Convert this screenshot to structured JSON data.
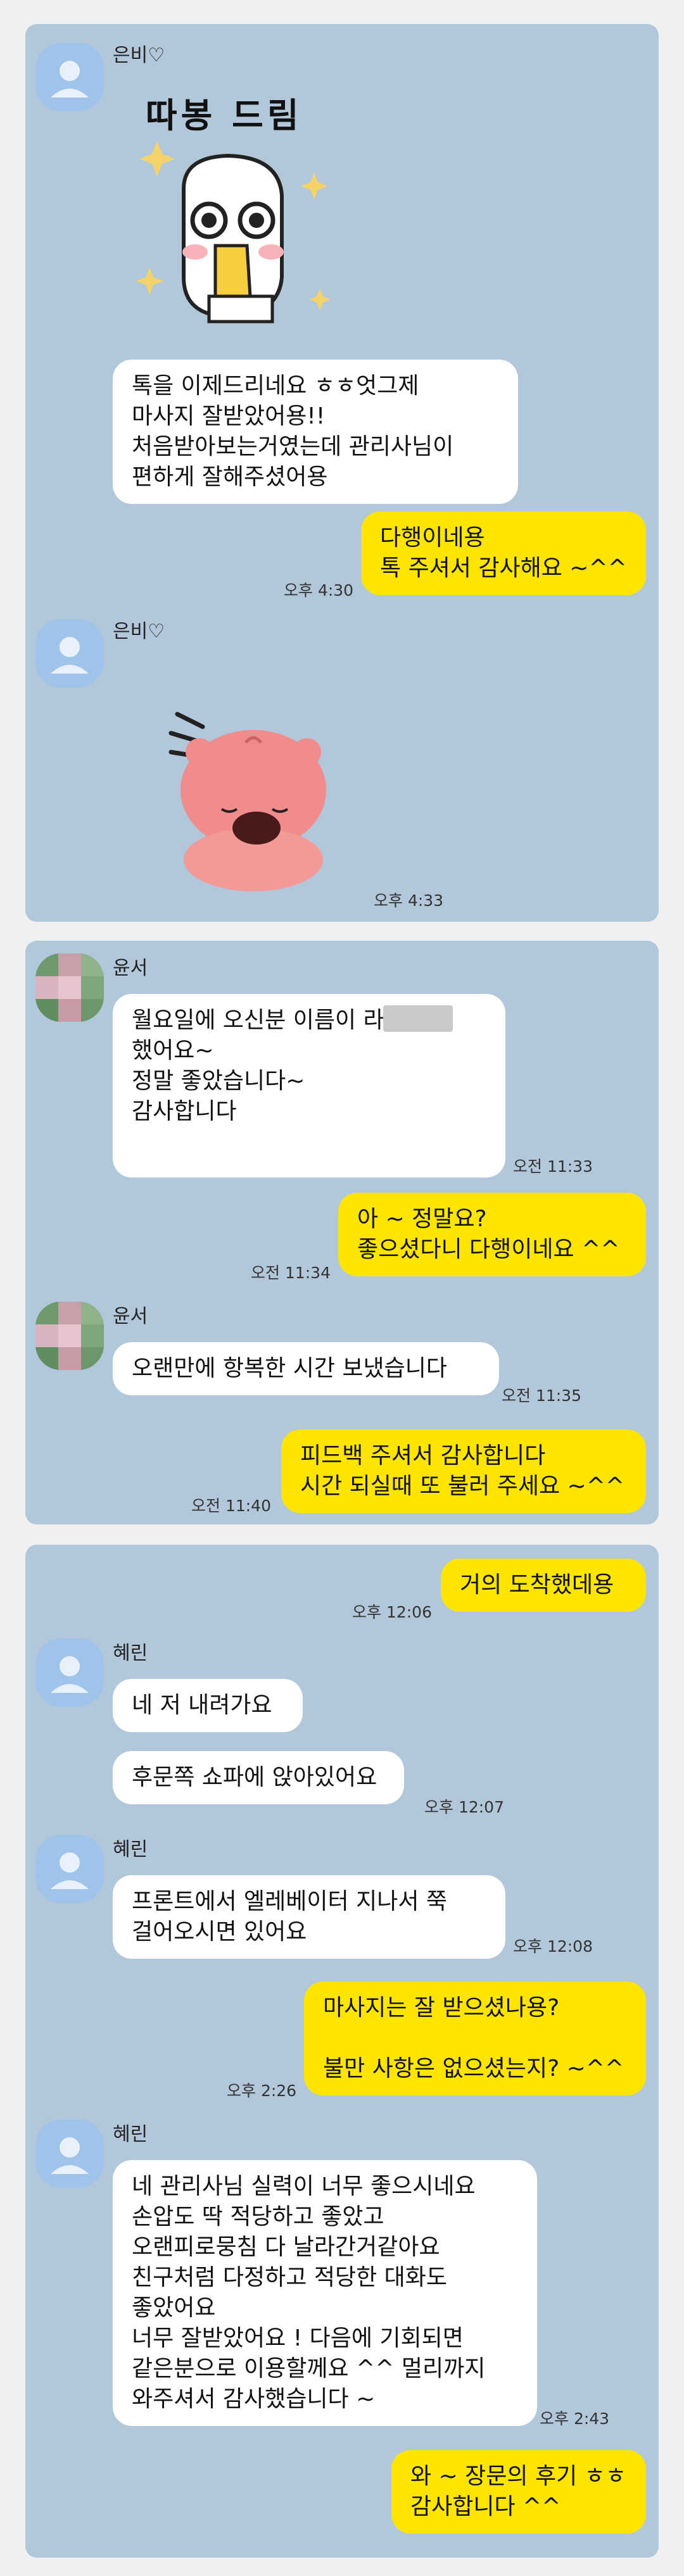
{
  "panel1": {
    "sender": "은비♡",
    "sticker_text": "따봉 드림",
    "msg1": "톡을 이제드리네요 ㅎㅎ엇그제\n마사지 잘받았어용!!\n처음받아보는거였는데 관리사님이\n편하게 잘해주셨어용",
    "reply1": "다행이네용\n톡 주셔서 감사해요 ~^^",
    "reply1_time": "오후 4:30",
    "sender2": "은비♡",
    "sticker2_time": "오후 4:33"
  },
  "panel2": {
    "sender": "윤서",
    "msg1": "월요일에 오신분 이름이  라고\n했어요~\n정말 좋았습니다~\n감사합니다",
    "msg1_time": "오전 11:33",
    "reply1": "아 ~ 정말요?\n좋으셨다니 다행이네요 ^^",
    "reply1_time": "오전 11:34",
    "sender2": "윤서",
    "msg2": "오랜만에 항복한 시간 보냈습니다",
    "msg2_time": "오전 11:35",
    "reply2": "피드백 주셔서 감사합니다\n시간 되실때 또 불러 주세요 ~^^",
    "reply2_time": "오전 11:40"
  },
  "panel3": {
    "reply1": "거의 도착했데용",
    "reply1_time": "오후 12:06",
    "sender": "혜린",
    "msg1": "네 저 내려가요",
    "msg2": "후문쪽 쇼파에 앉아있어요",
    "msg2_time": "오후 12:07",
    "sender2": "혜린",
    "msg3": "프론트에서 엘레베이터 지나서 쭉\n걸어오시면 있어요",
    "msg3_time": "오후 12:08",
    "reply2": "마사지는 잘 받으셨나용?\n\n불만 사항은 없으셨는지? ~^^",
    "reply2_time": "오후 2:26",
    "sender3": "혜린",
    "msg4": "네 관리사님 실력이 너무 좋으시네요\n손압도 딱 적당하고 좋았고\n오랜피로뭉침 다 날라간거같아요\n친구처럼 다정하고 적당한 대화도\n좋았어요\n너무 잘받았어요 ! 다음에 기회되면\n같은분으로 이용할께요 ^^ 멀리까지\n와주셔서 감사했습니다 ~",
    "msg4_time": "오후 2:43",
    "reply3": "와 ~ 장문의 후기 ㅎㅎ\n감사합니다 ^^"
  },
  "icons": {
    "avatar_default": "person-silhouette-icon",
    "avatar_blurred": "mosaic-avatar-icon"
  },
  "colors": {
    "chat_bg": "#b2c7d9",
    "outgoing_bubble": "#fee500",
    "incoming_bubble": "#ffffff"
  }
}
